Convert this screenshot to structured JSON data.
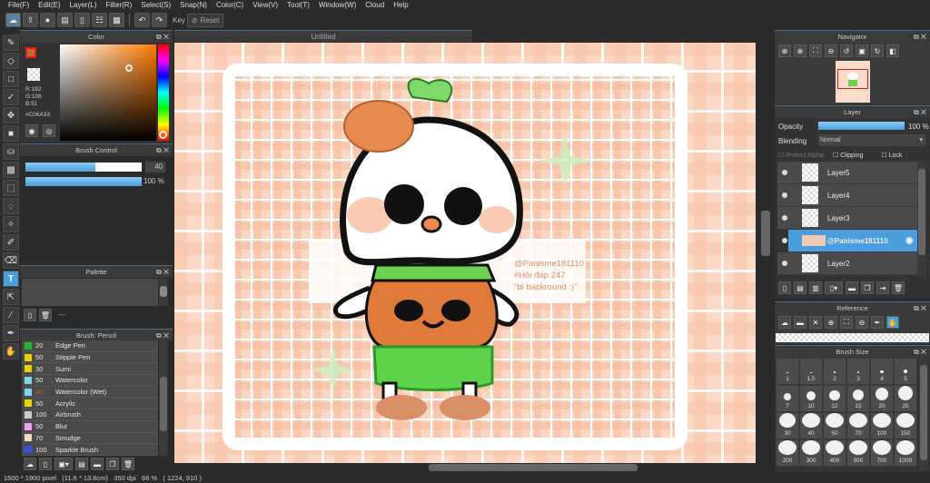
{
  "menu": [
    "File(F)",
    "Edit(E)",
    "Layer(L)",
    "Filter(R)",
    "Select(S)",
    "Snap(N)",
    "Color(C)",
    "View(V)",
    "Tool(T)",
    "Window(W)",
    "Cloud",
    "Help"
  ],
  "toolbar": {
    "key_label": "Key",
    "reset_label": "Reset"
  },
  "document_tab": "Untitled",
  "color_panel": {
    "title": "Color",
    "r": "R:192",
    "g": "G:106",
    "b": "B:51",
    "hex": "#C06A33",
    "fg_color": "#C06A33"
  },
  "brush_control": {
    "title": "Brush Control",
    "size": "40",
    "size_fraction": 0.6,
    "opacity": "100 %",
    "opacity_fraction": 1.0
  },
  "palette": {
    "title": "Palette",
    "footer_text": "---"
  },
  "brush_list": {
    "title": "Brush: Pencil",
    "items": [
      {
        "size": "20",
        "name": "Edge Pen",
        "color": "#22bb22"
      },
      {
        "size": "50",
        "name": "Stipple Pen",
        "color": "#e6d200"
      },
      {
        "size": "30",
        "name": "Sumi",
        "color": "#e6d200"
      },
      {
        "size": "50",
        "name": "Watercolor",
        "color": "#7fd8f0"
      },
      {
        "size": "40",
        "name": "Watercolor (Wet)",
        "color": "#7fd8f0",
        "size_color": "#e05050"
      },
      {
        "size": "50",
        "name": "Acrylic",
        "color": "#e6d200"
      },
      {
        "size": "100",
        "name": "Airbrush",
        "color": "#cccccc"
      },
      {
        "size": "50",
        "name": "Blur",
        "color": "#f0a0f0"
      },
      {
        "size": "70",
        "name": "Smudge",
        "color": "#f5dcc0"
      },
      {
        "size": "100",
        "name": "Sparkle Brush",
        "color": "#3355ee"
      }
    ]
  },
  "navigator": {
    "title": "Navigator"
  },
  "layer_panel": {
    "title": "Layer",
    "opacity_label": "Opacity",
    "opacity_value": "100 %",
    "blending_label": "Blending",
    "blending_value": "Normal",
    "protect_alpha": "Protect Alpha",
    "clipping": "Clipping",
    "lock": "Lock",
    "layers": [
      {
        "name": "Layer5"
      },
      {
        "name": "Layer4"
      },
      {
        "name": "Layer3"
      },
      {
        "name": "@Panisme181110",
        "selected": true
      },
      {
        "name": "Layer2"
      }
    ]
  },
  "reference": {
    "title": "Reference"
  },
  "brush_size": {
    "title": "Brush Size",
    "sizes": [
      "1",
      "1.5",
      "2",
      "3",
      "4",
      "5",
      "7",
      "10",
      "12",
      "15",
      "20",
      "25",
      "30",
      "40",
      "50",
      "70",
      "100",
      "150",
      "200",
      "300",
      "400",
      "500",
      "700",
      "1000"
    ]
  },
  "canvas_text": {
    "line1": "@Panisme181110",
    "line2": "#Hỏi đáp 247",
    "line3": "\"bi backround :)\""
  },
  "status_bar": "1600 * 1900 pixel   (11.6 * 13.8cm)   350 dpi   66 %   ( 1224, 910 )"
}
